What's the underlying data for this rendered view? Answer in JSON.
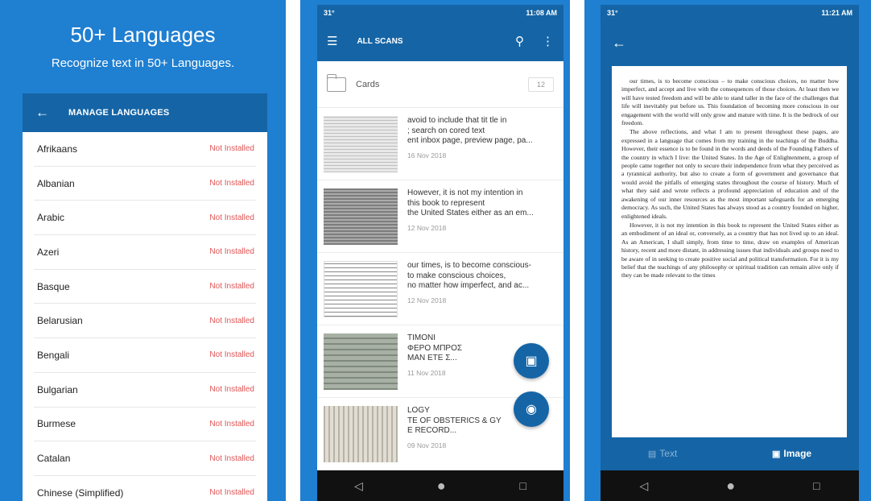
{
  "panel1": {
    "promo_title": "50+ Languages",
    "promo_subtitle": "Recognize text in 50+ Languages.",
    "appbar_title": "MANAGE LANGUAGES",
    "languages": [
      {
        "name": "Afrikaans",
        "status": "Not Installed"
      },
      {
        "name": "Albanian",
        "status": "Not Installed"
      },
      {
        "name": "Arabic",
        "status": "Not Installed"
      },
      {
        "name": "Azeri",
        "status": "Not Installed"
      },
      {
        "name": "Basque",
        "status": "Not Installed"
      },
      {
        "name": "Belarusian",
        "status": "Not Installed"
      },
      {
        "name": "Bengali",
        "status": "Not Installed"
      },
      {
        "name": "Bulgarian",
        "status": "Not Installed"
      },
      {
        "name": "Burmese",
        "status": "Not Installed"
      },
      {
        "name": "Catalan",
        "status": "Not Installed"
      },
      {
        "name": "Chinese (Simplified)",
        "status": "Not Installed"
      }
    ]
  },
  "panel2": {
    "status_left": "31°",
    "status_right": "11:08 AM",
    "appbar_title": "ALL SCANS",
    "folder": {
      "name": "Cards",
      "count": "12"
    },
    "scans": [
      {
        "lines": [
          "avoid to include that tit tle in",
          "; search on cored text",
          "ent inbox page, preview page, pa..."
        ],
        "date": "16 Nov 2018"
      },
      {
        "lines": [
          "However, it is not my intention in",
          "this book to represent",
          "the United States either as an em..."
        ],
        "date": "12 Nov 2018"
      },
      {
        "lines": [
          "our times, is to become conscious-",
          "to make conscious choices,",
          "no matter how imperfect, and ac..."
        ],
        "date": "12 Nov 2018"
      },
      {
        "lines": [
          "TIMONI",
          "ΦΕΡΟ ΜΠΡΟΣ",
          "MAN ETE Σ..."
        ],
        "date": "11 Nov 2018"
      },
      {
        "lines": [
          "LOGY",
          "TE OF OBSTERICS & GY",
          "E RECORD..."
        ],
        "date": "09 Nov 2018"
      }
    ]
  },
  "panel3": {
    "status_left": "31°",
    "status_right": "11:21 AM",
    "paragraphs": [
      "our times, is to become conscious – to make conscious choices, no matter how imperfect, and accept and live with the consequences of those choices. At least then we will have tested freedom and will be able to stand taller in the face of the challenges that life will inevitably put before us. This foundation of becoming more conscious in our engagement with the world will only grow and mature with time. It is the bedrock of our freedom.",
      "The above reflections, and what I am to present throughout these pages, are expressed in a language that comes from my training in the teachings of the Buddha. However, their essence is to be found in the words and deeds of the Founding Fathers of the country in which I live: the United States. In the Age of Enlightenment, a group of people came together not only to secure their independence from what they perceived as a tyrannical authority, but also to create a form of government and governance that would avoid the pitfalls of emerging states throughout the course of history. Much of what they said and wrote reflects a profound appreciation of education and of the awakening of our inner resources as the most important safeguards for an emerging democracy. As such, the United States has always stood as a country founded on higher, enlightened ideals.",
      "However, it is not my intention in this book to represent the United States either as an embodiment of an ideal or, conversely, as a country that has not lived up to an ideal. As an American, I shall simply, from time to time, draw on examples of American history, recent and more distant, in addressing issues that individuals and groups need to be aware of in seeking to create positive social and political transformation. For it is my belief that the teachings of any philosophy or spiritual tradition can remain alive only if they can be made relevant to the times"
    ],
    "tab_text": "Text",
    "tab_image": "Image"
  }
}
